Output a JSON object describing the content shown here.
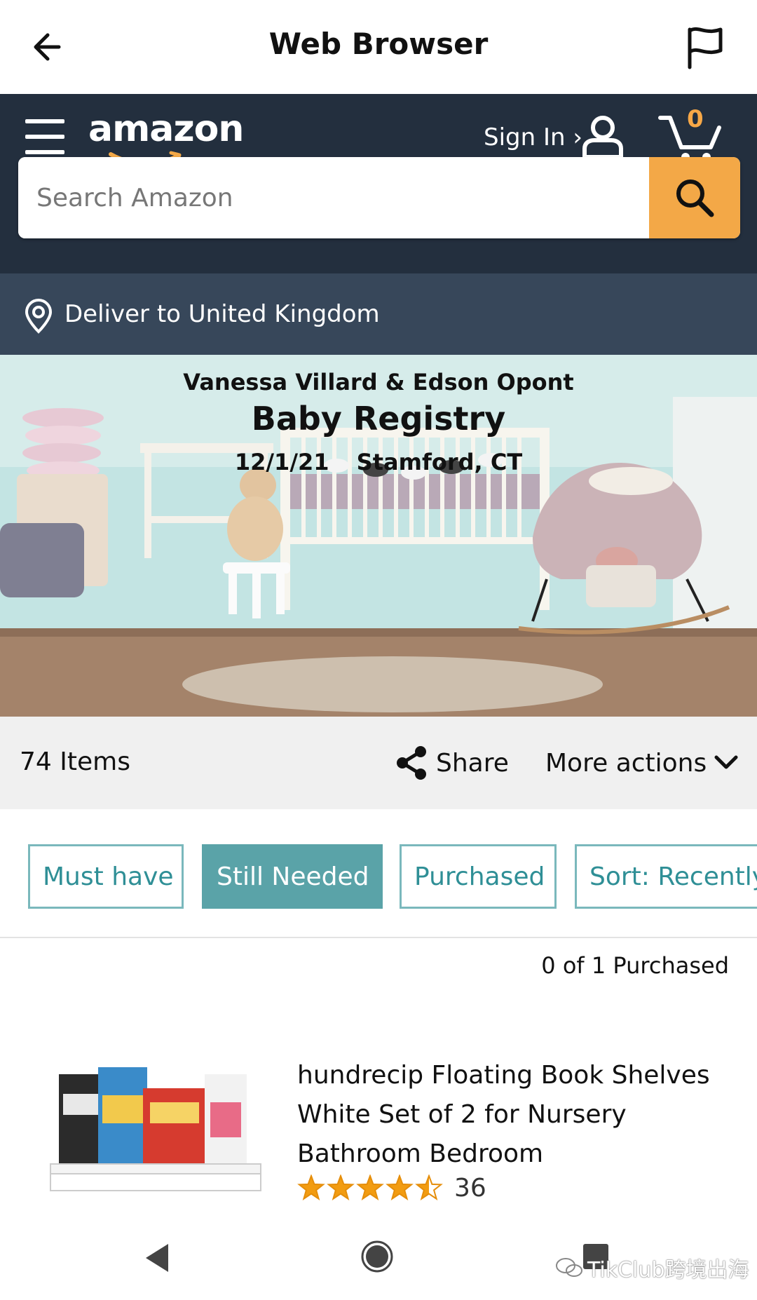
{
  "browser": {
    "title": "Web Browser",
    "back_icon": "arrow-left-icon",
    "report_icon": "flag-icon"
  },
  "header": {
    "logo_text": "amazon",
    "sign_in": "Sign In ›",
    "cart_count": "0",
    "brand_color": "#232f3e",
    "accent_color": "#f3a847"
  },
  "search": {
    "placeholder": "Search Amazon",
    "value": ""
  },
  "deliver": {
    "text": "Deliver to United Kingdom"
  },
  "registry": {
    "names": "Vanessa Villard & Edson Opont",
    "title": "Baby Registry",
    "date": "12/1/21",
    "location": "Stamford, CT"
  },
  "toolbar": {
    "items_count": "74 Items",
    "share_label": "Share",
    "more_label": "More actions"
  },
  "filters": [
    {
      "label": "Must have",
      "active": false
    },
    {
      "label": "Still Needed",
      "active": true
    },
    {
      "label": "Purchased",
      "active": false
    },
    {
      "label": "Sort: Recently",
      "active": false
    }
  ],
  "status": {
    "purchased": "0 of 1 Purchased"
  },
  "product": {
    "title": "hundrecip Floating Book Shelves White Set of 2 for Nursery Bathroom Bedroom",
    "rating": 4.5,
    "rating_max": 5,
    "review_count": "36"
  },
  "watermark": {
    "text": "TikClub跨境出海"
  }
}
